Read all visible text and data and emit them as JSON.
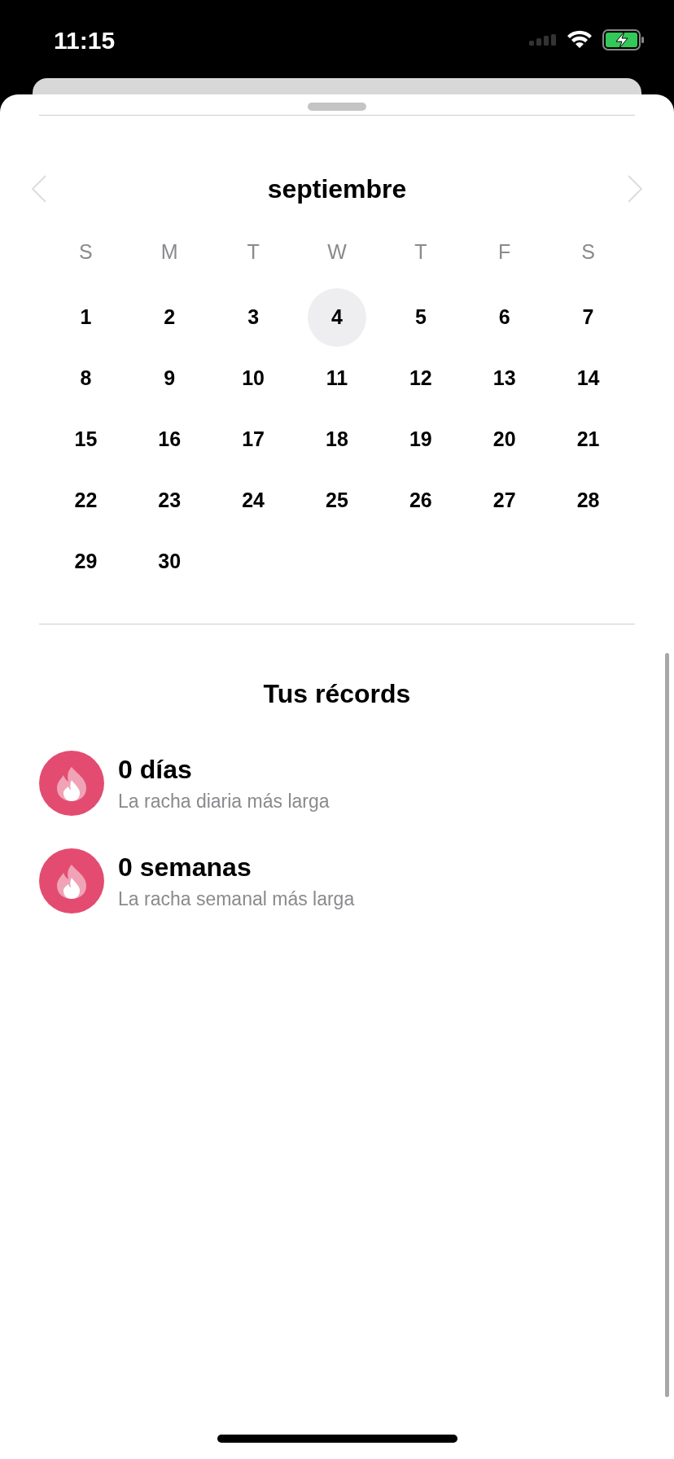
{
  "status_bar": {
    "time": "11:15"
  },
  "calendar": {
    "month": "septiembre",
    "weekdays": [
      "S",
      "M",
      "T",
      "W",
      "T",
      "F",
      "S"
    ],
    "days": [
      {
        "label": "1",
        "selected": false
      },
      {
        "label": "2",
        "selected": false
      },
      {
        "label": "3",
        "selected": false
      },
      {
        "label": "4",
        "selected": true
      },
      {
        "label": "5",
        "selected": false
      },
      {
        "label": "6",
        "selected": false
      },
      {
        "label": "7",
        "selected": false
      },
      {
        "label": "8",
        "selected": false
      },
      {
        "label": "9",
        "selected": false
      },
      {
        "label": "10",
        "selected": false
      },
      {
        "label": "11",
        "selected": false
      },
      {
        "label": "12",
        "selected": false
      },
      {
        "label": "13",
        "selected": false
      },
      {
        "label": "14",
        "selected": false
      },
      {
        "label": "15",
        "selected": false
      },
      {
        "label": "16",
        "selected": false
      },
      {
        "label": "17",
        "selected": false
      },
      {
        "label": "18",
        "selected": false
      },
      {
        "label": "19",
        "selected": false
      },
      {
        "label": "20",
        "selected": false
      },
      {
        "label": "21",
        "selected": false
      },
      {
        "label": "22",
        "selected": false
      },
      {
        "label": "23",
        "selected": false
      },
      {
        "label": "24",
        "selected": false
      },
      {
        "label": "25",
        "selected": false
      },
      {
        "label": "26",
        "selected": false
      },
      {
        "label": "27",
        "selected": false
      },
      {
        "label": "28",
        "selected": false
      },
      {
        "label": "29",
        "selected": false
      },
      {
        "label": "30",
        "selected": false
      }
    ]
  },
  "records": {
    "title": "Tus récords",
    "items": [
      {
        "value": "0 días",
        "caption": "La racha diaria más larga"
      },
      {
        "value": "0 semanas",
        "caption": "La racha semanal más larga"
      }
    ]
  }
}
